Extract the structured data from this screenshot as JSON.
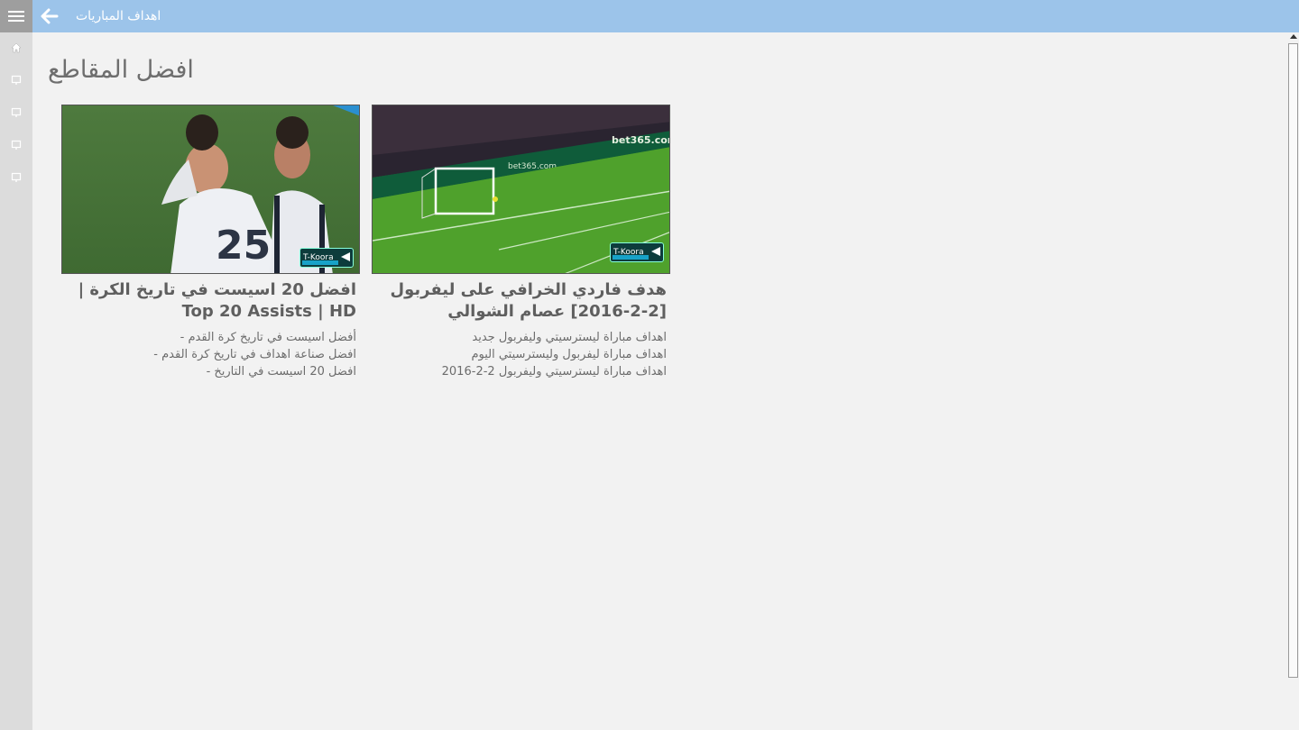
{
  "header": {
    "title": "اهداف المباريات",
    "back_icon": "arrow-left-icon",
    "background": "#9cc4ea"
  },
  "rail": {
    "menu_icon": "hamburger-menu-icon",
    "items": [
      {
        "icon": "home-icon"
      },
      {
        "icon": "monitor-icon"
      },
      {
        "icon": "monitor-icon"
      },
      {
        "icon": "monitor-icon"
      },
      {
        "icon": "monitor-icon"
      }
    ]
  },
  "main": {
    "section_title": "افضل المقاطع",
    "videos": [
      {
        "title": "افضل 20 اسيست في تاريخ الكرة | Top 20 Assists | HD",
        "description": "أفضل اسيست في تاريخ كرة القدم -\nافضل صناعة اهداف في تاريخ كرة القدم -\nافضل 20 اسيست في التاريخ -",
        "watermark": "T-Koora"
      },
      {
        "title": "هدف فاردي الخرافي على ليفربول [2-2-2016] عصام الشوالي",
        "description": "اهداف مباراة ليسترسيتي وليفربول جديد\nاهداف مباراة ليفربول وليسترسيتي اليوم\nاهداف مباراة ليسترسيتي وليفربول 2-2-2016",
        "watermark": "T-Koora"
      }
    ]
  }
}
